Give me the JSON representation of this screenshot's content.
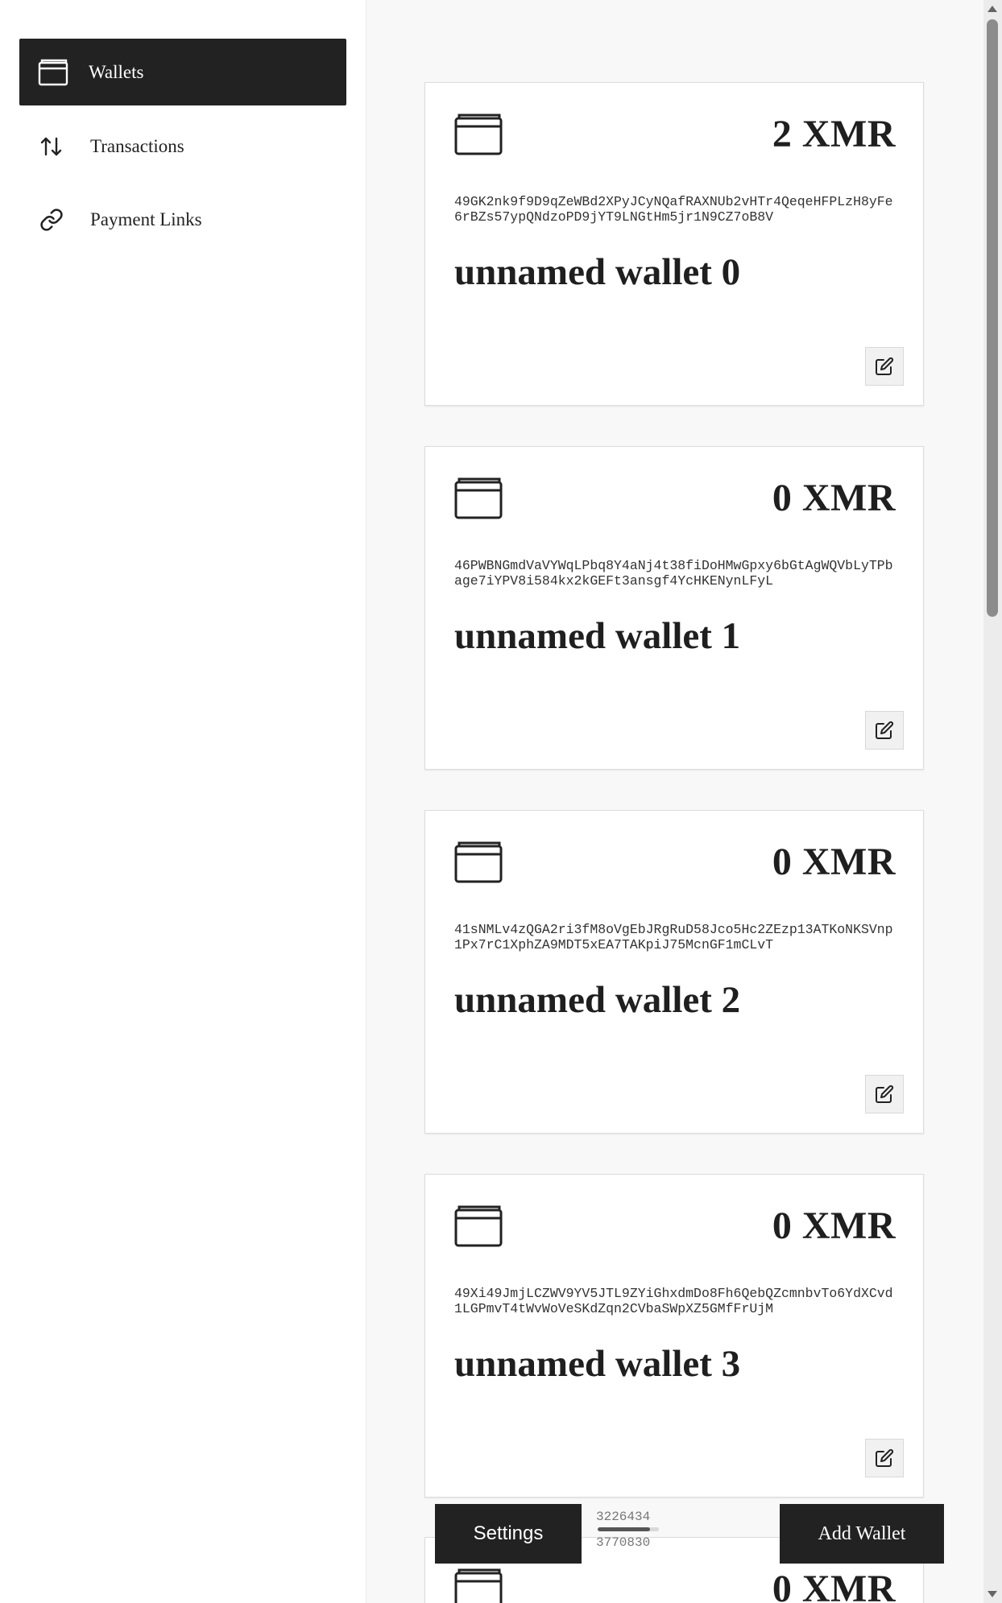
{
  "sidebar": {
    "items": [
      {
        "label": "Wallets",
        "icon": "wallet-icon",
        "active": true
      },
      {
        "label": "Transactions",
        "icon": "arrows-up-down-icon",
        "active": false
      },
      {
        "label": "Payment Links",
        "icon": "link-icon",
        "active": false
      }
    ]
  },
  "wallets": [
    {
      "balance": "2 XMR",
      "address": "49GK2nk9f9D9qZeWBd2XPyJCyNQafRAXNUb2vHTr4QeqeHFPLzH8yFe6rBZs57ypQNdzoPD9jYT9LNGtHm5jr1N9CZ7oB8V",
      "name": "unnamed wallet 0"
    },
    {
      "balance": "0 XMR",
      "address": "46PWBNGmdVaVYWqLPbq8Y4aNj4t38fiDoHMwGpxy6bGtAgWQVbLyTPbage7iYPV8i584kx2kGEFt3ansgf4YcHKENynLFyL",
      "name": "unnamed wallet 1"
    },
    {
      "balance": "0 XMR",
      "address": "41sNMLv4zQGA2ri3fM8oVgEbJRgRuD58Jco5Hc2ZEzp13ATKoNKSVnp1Px7rC1XphZA9MDT5xEA7TAKpiJ75McnGF1mCLvT",
      "name": "unnamed wallet 2"
    },
    {
      "balance": "0 XMR",
      "address": "49Xi49JmjLCZWV9YV5JTL9ZYiGhxdmDo8Fh6QebQZcmnbvTo6YdXCvd1LGPmvT4tWvWoVeSKdZqn2CVbaSWpXZ5GMfFrUjM",
      "name": "unnamed wallet 3"
    },
    {
      "balance": "0 XMR"
    }
  ],
  "footer": {
    "settings_label": "Settings",
    "add_wallet_label": "Add Wallet",
    "sync_current": "3226434",
    "sync_target": "3770830",
    "sync_progress": 0.856
  },
  "colors": {
    "dark": "#222222",
    "background": "#f8f8f8",
    "card": "#ffffff"
  }
}
